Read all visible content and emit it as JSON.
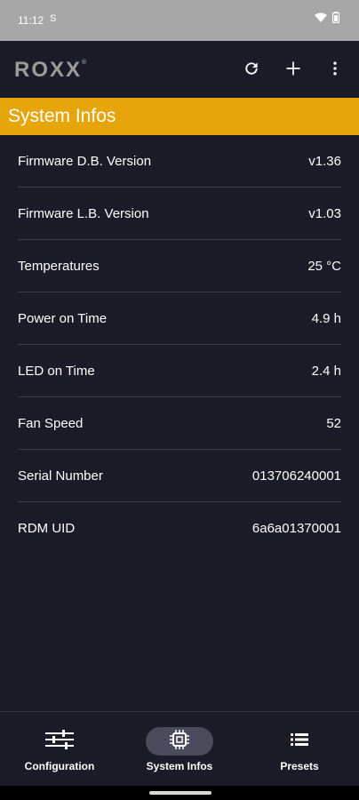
{
  "status_bar": {
    "time": "11:12",
    "notification": "S",
    "icons": [
      "wifi-icon",
      "battery-icon"
    ]
  },
  "app_bar": {
    "logo": "ROXX",
    "logo_mark": "®",
    "actions": [
      "refresh-icon",
      "add-icon",
      "more-vert-icon"
    ]
  },
  "section": {
    "title": "System Infos",
    "accent": "#e6a50a"
  },
  "info_rows": [
    {
      "label": "Firmware D.B. Version",
      "value": "v1.36"
    },
    {
      "label": "Firmware L.B. Version",
      "value": "v1.03"
    },
    {
      "label": "Temperatures",
      "value": "25 °C"
    },
    {
      "label": "Power on Time",
      "value": "4.9 h"
    },
    {
      "label": "LED on Time",
      "value": "2.4 h"
    },
    {
      "label": "Fan Speed",
      "value": "52"
    },
    {
      "label": "Serial Number",
      "value": "013706240001"
    },
    {
      "label": "RDM UID",
      "value": "6a6a01370001"
    }
  ],
  "bottom_nav": {
    "items": [
      {
        "label": "Configuration",
        "icon": "sliders-icon",
        "active": false
      },
      {
        "label": "System Infos",
        "icon": "chip-icon",
        "active": true
      },
      {
        "label": "Presets",
        "icon": "list-icon",
        "active": false
      }
    ]
  },
  "colors": {
    "background": "#1b1c28",
    "status_bar": "#a7a7a7",
    "active_pill": "#4a4b5d"
  }
}
